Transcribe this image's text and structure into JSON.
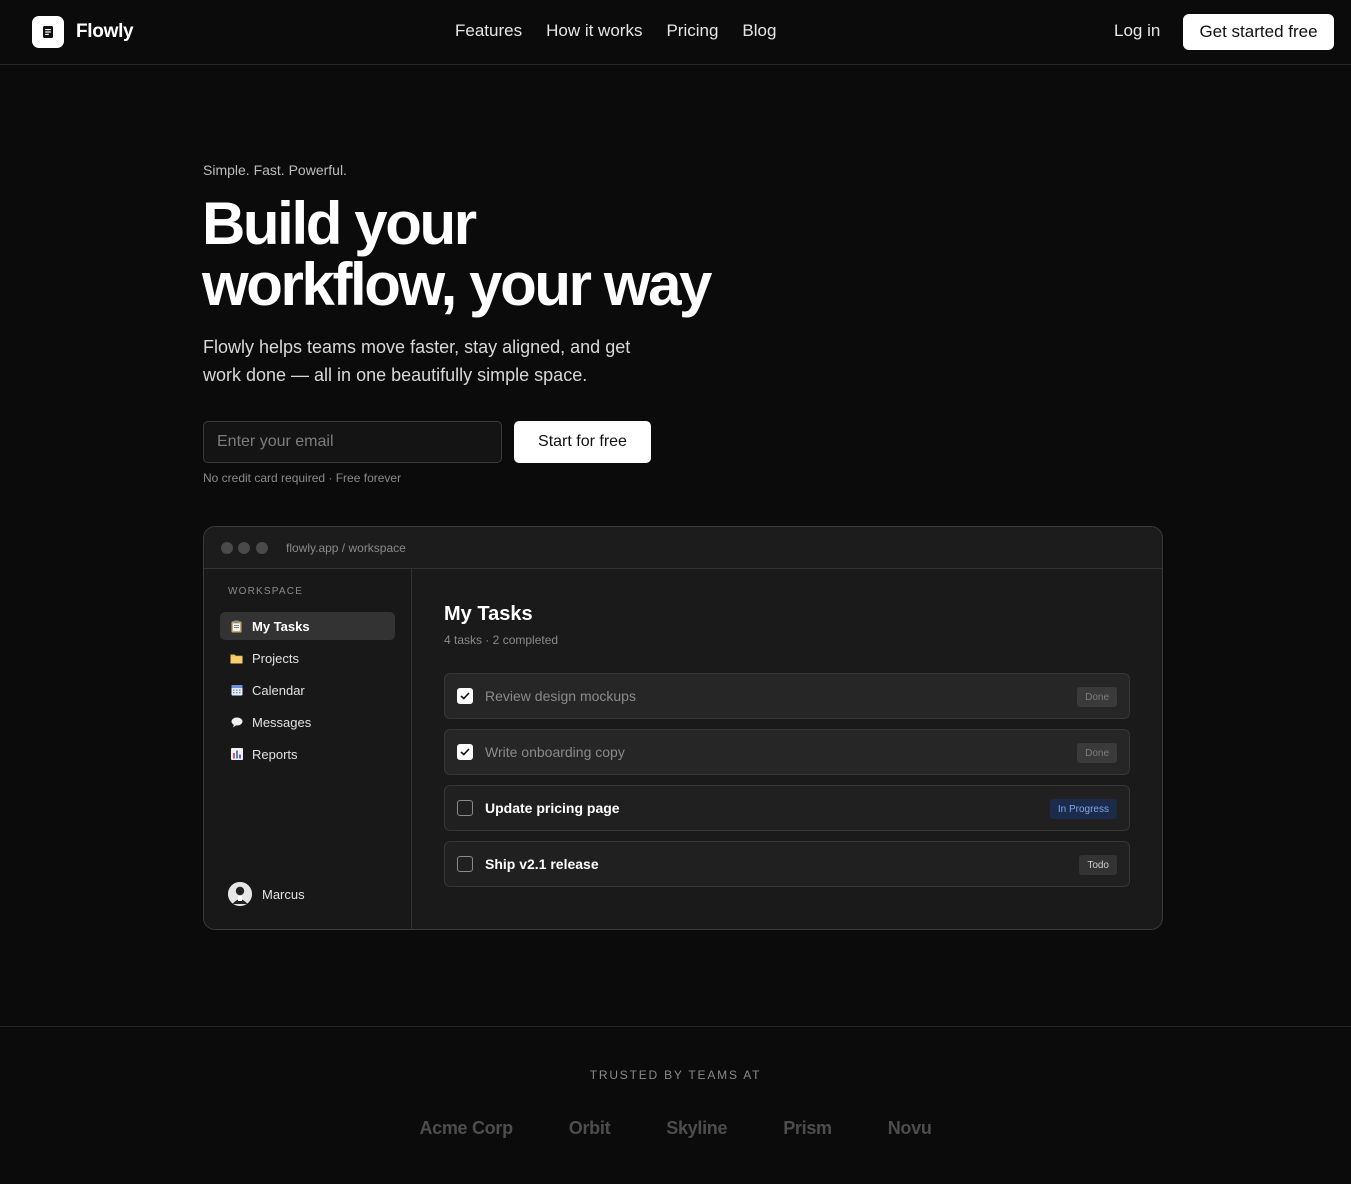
{
  "nav": {
    "brand": "Flowly",
    "links": [
      "Features",
      "How it works",
      "Pricing",
      "Blog"
    ],
    "login": "Log in",
    "cta": "Get started free"
  },
  "hero": {
    "eyebrow": "Simple. Fast. Powerful.",
    "title_line1": "Build your",
    "title_line2": "workflow, your way",
    "subtitle": "Flowly helps teams move faster, stay aligned, and get work done — all in one beautifully simple space.",
    "email_placeholder": "Enter your email",
    "button": "Start for free",
    "fine_print": "No credit card required · Free forever"
  },
  "app": {
    "url": "flowly.app / workspace",
    "workspace_label": "WORKSPACE",
    "sidebar": [
      {
        "label": "My Tasks",
        "icon": "clipboard-icon",
        "active": true
      },
      {
        "label": "Projects",
        "icon": "folder-icon",
        "active": false
      },
      {
        "label": "Calendar",
        "icon": "calendar-icon",
        "active": false
      },
      {
        "label": "Messages",
        "icon": "speech-bubble-icon",
        "active": false
      },
      {
        "label": "Reports",
        "icon": "bar-chart-icon",
        "active": false
      }
    ],
    "user": "Marcus",
    "main_title": "My Tasks",
    "main_sub": "4 tasks · 2 completed",
    "tasks": [
      {
        "label": "Review design mockups",
        "done": true,
        "status": "Done"
      },
      {
        "label": "Write onboarding copy",
        "done": true,
        "status": "Done"
      },
      {
        "label": "Update pricing page",
        "done": false,
        "status": "In Progress"
      },
      {
        "label": "Ship v2.1 release",
        "done": false,
        "status": "Todo"
      }
    ]
  },
  "trusted": {
    "label": "TRUSTED BY TEAMS AT",
    "logos": [
      "Acme Corp",
      "Orbit",
      "Skyline",
      "Prism",
      "Novu"
    ]
  },
  "colors": {
    "background": "#0b0b0b",
    "in_progress_badge": "#1c2b4a",
    "in_progress_text": "#7fa8f0"
  }
}
